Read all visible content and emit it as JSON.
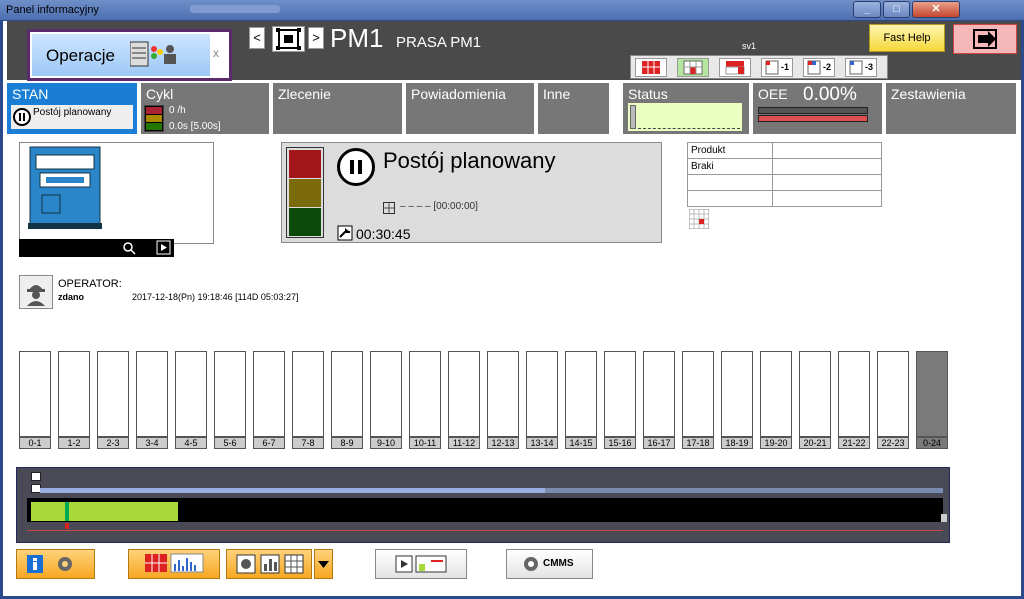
{
  "window": {
    "title": "Panel informacyjny"
  },
  "header": {
    "operations_label": "Operacje",
    "operations_close": "x",
    "nav_prev": "<",
    "nav_next": ">",
    "machine_code": "PM1",
    "machine_name": "PRASA PM1",
    "shift": "sv1",
    "fast_help": "Fast Help"
  },
  "view_strip": {
    "items": [
      {
        "label": ""
      },
      {
        "label": "",
        "active": true
      },
      {
        "label": ""
      },
      {
        "label": "-1"
      },
      {
        "label": "-2"
      },
      {
        "label": "-3"
      }
    ]
  },
  "tiles": {
    "stan": {
      "title": "STAN",
      "state": "Postój planowany"
    },
    "cykl": {
      "title": "Cykl",
      "rate": "0 /h",
      "time": "0.0s [5.00s]"
    },
    "zlecenie": {
      "title": "Zlecenie"
    },
    "powiadomienia": {
      "title": "Powiadomienia"
    },
    "inne": {
      "title": "Inne"
    },
    "status": {
      "title": "Status"
    },
    "oee": {
      "title": "OEE",
      "value": "0.00%"
    },
    "zestawienia": {
      "title": "Zestawienia"
    }
  },
  "state_panel": {
    "label": "Postój planowany",
    "sub": "– – – –   [00:00:00]",
    "elapsed": "00:30:45"
  },
  "product": {
    "rows": [
      {
        "key": "Produkt",
        "value": ""
      },
      {
        "key": "Braki",
        "value": ""
      },
      {
        "key": "",
        "value": ""
      },
      {
        "key": "",
        "value": ""
      }
    ]
  },
  "operator": {
    "label": "OPERATOR:",
    "state": "zdano",
    "timestamp": "2017-12-18(Pn)  19:18:46  [114D 05:03:27]"
  },
  "hours": [
    "0-1",
    "1-2",
    "2-3",
    "3-4",
    "4-5",
    "5-6",
    "6-7",
    "7-8",
    "8-9",
    "9-10",
    "10-11",
    "11-12",
    "12-13",
    "13-14",
    "14-15",
    "15-16",
    "16-17",
    "17-18",
    "18-19",
    "19-20",
    "20-21",
    "21-22",
    "22-23",
    "0-24"
  ],
  "toolbar": {
    "cmms_label": "CMMS"
  },
  "colors": {
    "tile_bg": "#777777",
    "stan_active": "#1a7fd4",
    "header_bg": "#4a4a4a",
    "green_bar": "#a8d93a",
    "oee_red": "#e05050"
  }
}
